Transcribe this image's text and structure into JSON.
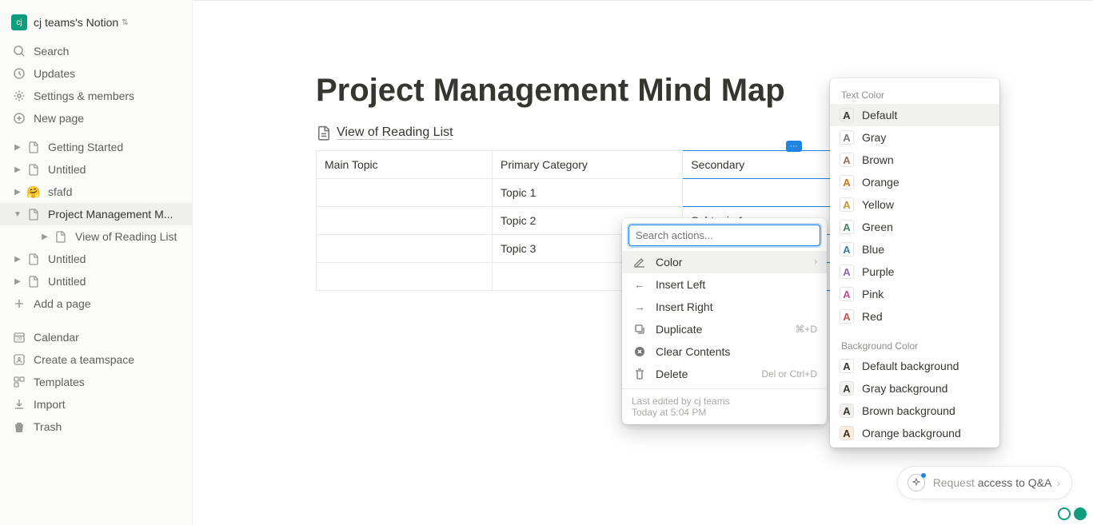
{
  "workspace": {
    "initials": "cj",
    "name": "cj teams's Notion"
  },
  "nav": {
    "search": "Search",
    "updates": "Updates",
    "settings": "Settings & members",
    "newPage": "New page"
  },
  "pages": {
    "gettingStarted": "Getting Started",
    "untitled1": "Untitled",
    "sfafd": "sfafd",
    "projectMgmt": "Project Management M...",
    "viewReading": "View of Reading List",
    "untitled2": "Untitled",
    "untitled3": "Untitled"
  },
  "addPage": "Add a page",
  "bottom": {
    "calendar": "Calendar",
    "teamspace": "Create a teamspace",
    "templates": "Templates",
    "import": "Import",
    "trash": "Trash"
  },
  "content": {
    "title": "Project Management Mind Map",
    "subtitle": "View of Reading List",
    "headers": [
      "Main Topic",
      "Primary Category",
      "Secondary"
    ],
    "rows": [
      [
        "",
        "Topic 1",
        ""
      ],
      [
        "",
        "Topic 2",
        "Subtopic 1"
      ],
      [
        "",
        "Topic 3",
        ""
      ],
      [
        "",
        "",
        ""
      ]
    ]
  },
  "actionMenu": {
    "placeholder": "Search actions...",
    "color": "Color",
    "insertLeft": "Insert Left",
    "insertRight": "Insert Right",
    "duplicate": "Duplicate",
    "duplicateHint": "⌘+D",
    "clear": "Clear Contents",
    "delete": "Delete",
    "deleteHint": "Del or Ctrl+D",
    "footer1": "Last edited by cj teams",
    "footer2": "Today at 5:04 PM"
  },
  "colorMenu": {
    "textColorTitle": "Text Color",
    "textColors": [
      {
        "name": "Default",
        "color": "#37352f"
      },
      {
        "name": "Gray",
        "color": "#787773"
      },
      {
        "name": "Brown",
        "color": "#9f6b53"
      },
      {
        "name": "Orange",
        "color": "#d9730d"
      },
      {
        "name": "Yellow",
        "color": "#cb912f"
      },
      {
        "name": "Green",
        "color": "#448361"
      },
      {
        "name": "Blue",
        "color": "#337ea9"
      },
      {
        "name": "Purple",
        "color": "#9065b0"
      },
      {
        "name": "Pink",
        "color": "#c14c8a"
      },
      {
        "name": "Red",
        "color": "#d44c47"
      }
    ],
    "bgColorTitle": "Background Color",
    "bgColors": [
      {
        "name": "Default background",
        "color": "#ffffff"
      },
      {
        "name": "Gray background",
        "color": "#f1f1ef"
      },
      {
        "name": "Brown background",
        "color": "#f4eeee"
      },
      {
        "name": "Orange background",
        "color": "#fbecdd"
      }
    ]
  },
  "qa": {
    "prefix": "Request ",
    "strong": "access to Q&A"
  }
}
